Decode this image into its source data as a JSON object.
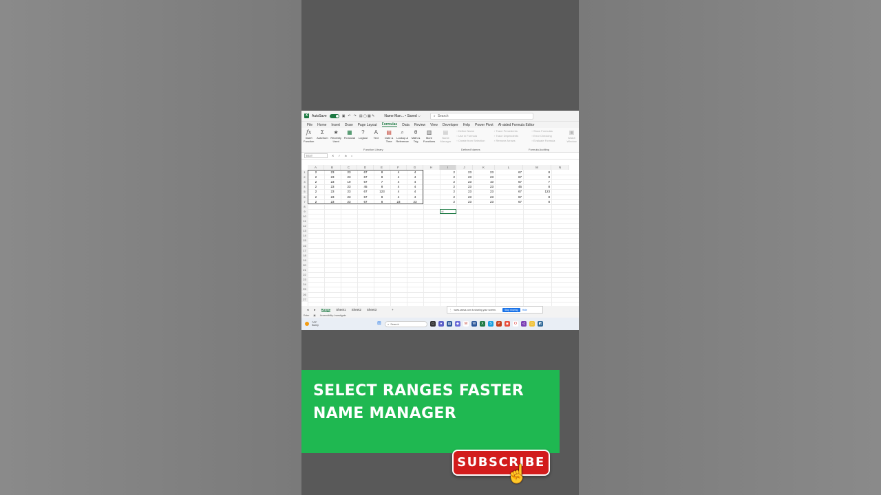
{
  "excel": {
    "autosave_label": "AutoSave",
    "filename": "Name Man... • Saved ⌵",
    "search_placeholder": "Search",
    "menu": [
      "File",
      "Home",
      "Insert",
      "Draw",
      "Page Layout",
      "Formulas",
      "Data",
      "Review",
      "View",
      "Developer",
      "Help",
      "Power Pivot",
      "AI-aided Formula Editor"
    ],
    "ribbon": {
      "insert_function": "Insert Function",
      "autosum": "AutoSum",
      "recently_used": "Recently Used",
      "financial": "Financial",
      "logical": "Logical",
      "text": "Text",
      "date_time": "Date & Time",
      "lookup_reference": "Lookup & Reference",
      "math_trig": "Math & Trig",
      "more_functions": "More Functions",
      "function_library": "Function Library",
      "name_manager": "Name Manager",
      "define_name": "Define Name",
      "use_in_formula": "Use in Formula",
      "create_from_selection": "Create from Selection",
      "defined_names": "Defined Names",
      "trace_precedents": "Trace Precedents",
      "trace_dependents": "Trace Dependents",
      "remove_arrows": "Remove Arrows",
      "show_formulas": "Show Formulas",
      "error_checking": "Error Checking",
      "evaluate_formula": "Evaluate Formula",
      "formula_auditing": "Formula Auditing",
      "watch_window": "Watch Window"
    },
    "namebox": "TEXT",
    "formula": "=",
    "columns": [
      "A",
      "B",
      "C",
      "D",
      "E",
      "F",
      "G",
      "H",
      "I",
      "J",
      "K",
      "L",
      "M",
      "N"
    ],
    "rows": [
      "1",
      "2",
      "3",
      "4",
      "5",
      "6",
      "7",
      "8",
      "9",
      "10",
      "11",
      "12",
      "13",
      "14",
      "15",
      "16",
      "17",
      "18",
      "19",
      "20",
      "21",
      "22",
      "23",
      "24",
      "25",
      "26",
      "27"
    ],
    "left_table": [
      [
        "2",
        "23",
        "23",
        "67",
        "8",
        "4",
        "4"
      ],
      [
        "2",
        "23",
        "23",
        "67",
        "8",
        "4",
        "4"
      ],
      [
        "2",
        "23",
        "10",
        "67",
        "7",
        "4",
        "4"
      ],
      [
        "2",
        "23",
        "23",
        "45",
        "8",
        "4",
        "4"
      ],
      [
        "2",
        "23",
        "23",
        "67",
        "123",
        "4",
        "4"
      ],
      [
        "2",
        "23",
        "23",
        "67",
        "8",
        "4",
        "4"
      ],
      [
        "2",
        "23",
        "23",
        "67",
        "8",
        "23",
        "23"
      ]
    ],
    "right_table": [
      [
        "2",
        "23",
        "23",
        "67",
        "8"
      ],
      [
        "2",
        "23",
        "23",
        "67",
        "8"
      ],
      [
        "2",
        "23",
        "10",
        "67",
        "7"
      ],
      [
        "2",
        "23",
        "23",
        "45",
        "8"
      ],
      [
        "2",
        "23",
        "23",
        "67",
        "123"
      ],
      [
        "2",
        "23",
        "23",
        "67",
        "8"
      ],
      [
        "2",
        "23",
        "23",
        "67",
        "8"
      ]
    ],
    "active_cell_text": "=I",
    "sheets": [
      "Range",
      "Sheet1",
      "Sheet2",
      "Sheet3"
    ],
    "add_sheet": "+",
    "share_text": "www.canva.com is sharing your screen.",
    "stop_sharing": "Stop sharing",
    "hide": "Hide",
    "status_mode": "Enter",
    "accessibility": "Accessibility: Investigate",
    "weather_temp": "74°F",
    "weather_desc": "Sunny",
    "taskbar_search": "Search"
  },
  "banner": {
    "line1": "SELECT RANGES FASTER",
    "line2": "NAME MANAGER"
  },
  "subscribe_label": "SUBSCRIBE",
  "colors": {
    "excel_green": "#1d7a43",
    "banner_green": "#1fb851",
    "subscribe_red": "#d21c1c"
  }
}
